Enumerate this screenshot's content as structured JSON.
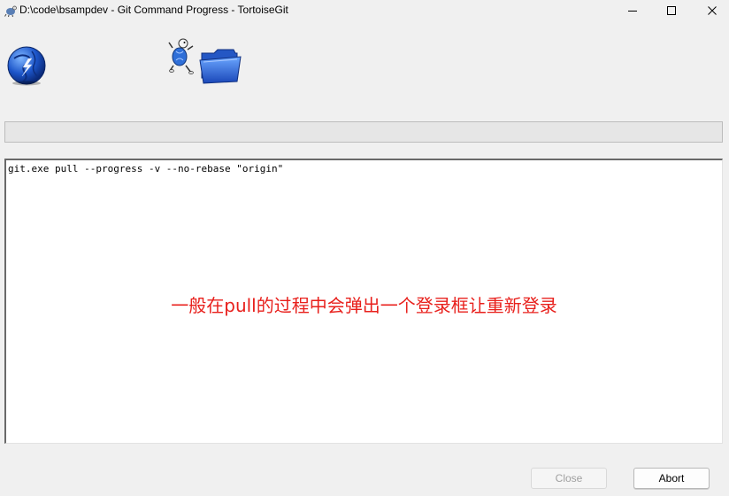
{
  "window": {
    "title": "D:\\code\\bsampdev - Git Command Progress - TortoiseGit"
  },
  "progress": {
    "value": 0
  },
  "log": {
    "lines": [
      "git.exe pull --progress -v --no-rebase \"origin\""
    ]
  },
  "annotation": {
    "text": "一般在pull的过程中会弹出一个登录框让重新登录",
    "color": "#e8201c"
  },
  "buttons": {
    "close_label": "Close",
    "abort_label": "Abort"
  }
}
